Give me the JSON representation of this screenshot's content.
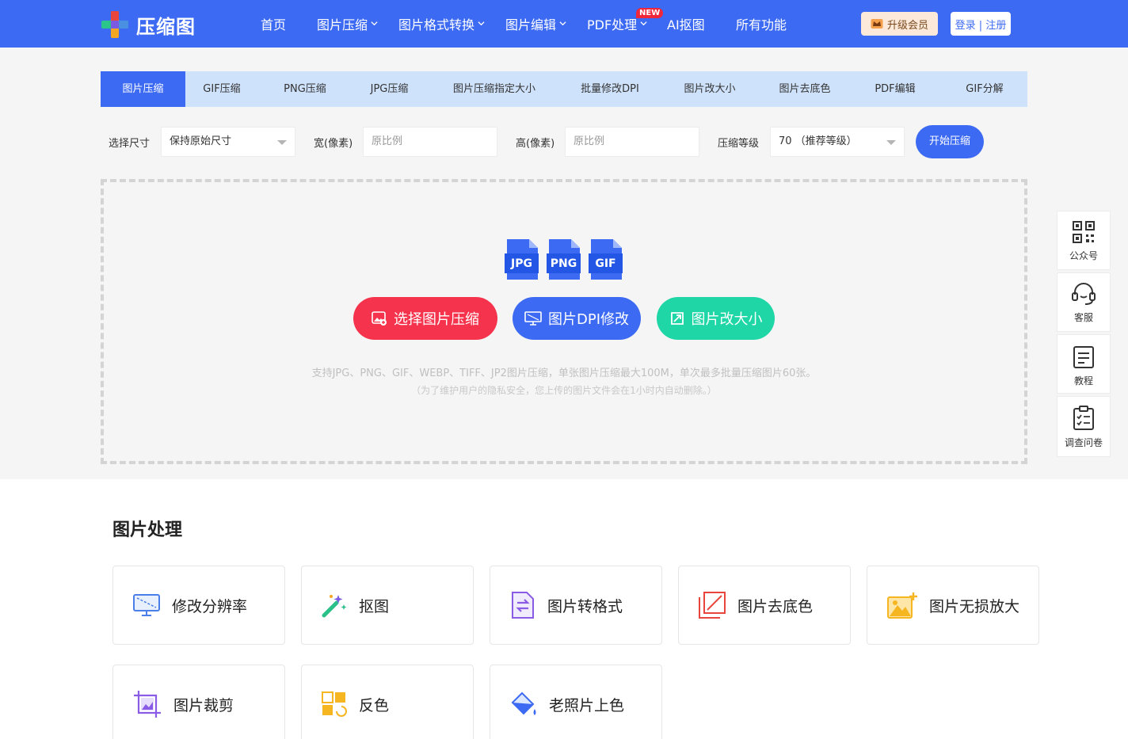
{
  "brand": {
    "name": "压缩图"
  },
  "nav": [
    {
      "label": "首页"
    },
    {
      "label": "图片压缩"
    },
    {
      "label": "图片格式转换"
    },
    {
      "label": "图片编辑"
    },
    {
      "label": "PDF处理",
      "badge": "NEW"
    },
    {
      "label": "AI抠图"
    },
    {
      "label": "所有功能"
    }
  ],
  "header_actions": {
    "vip": "升级会员",
    "login": "登录 | 注册"
  },
  "tabs": [
    {
      "label": "图片压缩",
      "active": true
    },
    {
      "label": "GIF压缩"
    },
    {
      "label": "PNG压缩"
    },
    {
      "label": "JPG压缩"
    },
    {
      "label": "图片压缩指定大小"
    },
    {
      "label": "批量修改DPI"
    },
    {
      "label": "图片改大小"
    },
    {
      "label": "图片去底色"
    },
    {
      "label": "PDF编辑"
    },
    {
      "label": "GIF分解"
    }
  ],
  "options": {
    "size_label": "选择尺寸",
    "size_value": "保持原始尺寸",
    "width_label": "宽(像素)",
    "width_placeholder": "原比例",
    "height_label": "高(像素)",
    "height_placeholder": "原比例",
    "level_label": "压缩等级",
    "level_value": "70 （推荐等级）",
    "start_button": "开始压缩"
  },
  "upload": {
    "file_types": [
      "JPG",
      "PNG",
      "GIF"
    ],
    "btn_compress": "选择图片压缩",
    "btn_dpi": "图片DPI修改",
    "btn_resize": "图片改大小",
    "hint": "支持JPG、PNG、GIF、WEBP、TIFF、JP2图片压缩，单张图片压缩最大100M，单次最多批量压缩图片60张。",
    "privacy": "（为了维护用户的隐私安全，您上传的图片文件会在1小时内自动删除。）"
  },
  "sidebar": [
    {
      "label": "公众号",
      "icon": "qrcode-icon"
    },
    {
      "label": "客服",
      "icon": "headset-icon"
    },
    {
      "label": "教程",
      "icon": "document-icon"
    },
    {
      "label": "调查问卷",
      "icon": "checklist-icon"
    }
  ],
  "section": {
    "title": "图片处理",
    "cards": [
      {
        "label": "修改分辨率",
        "icon": "monitor-icon"
      },
      {
        "label": "抠图",
        "icon": "magic-wand-icon"
      },
      {
        "label": "图片转格式",
        "icon": "convert-icon"
      },
      {
        "label": "图片去底色",
        "icon": "remove-bg-icon"
      },
      {
        "label": "图片无损放大",
        "icon": "enlarge-image-icon"
      },
      {
        "label": "图片裁剪",
        "icon": "crop-icon"
      },
      {
        "label": "反色",
        "icon": "invert-icon"
      },
      {
        "label": "老照片上色",
        "icon": "paint-bucket-icon"
      }
    ]
  },
  "colors": {
    "primary": "#3d6af3",
    "red_button": "#f5334d",
    "teal_button": "#1ed6a6",
    "tab_bar": "#cfe2fb"
  }
}
